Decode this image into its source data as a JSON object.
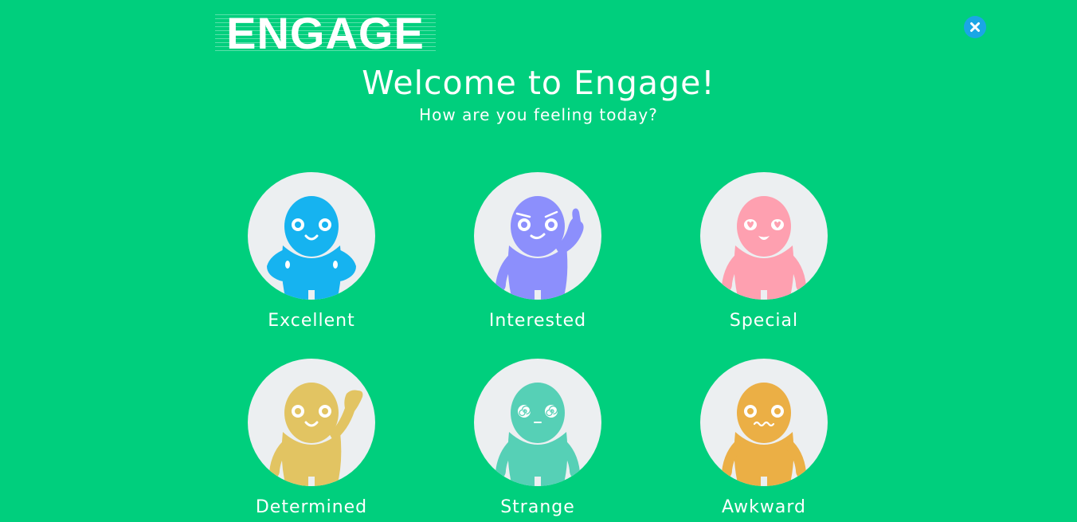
{
  "colors": {
    "background": "#00cf7d",
    "close_button": "#1aa6e6",
    "circle_background": "#eceff1",
    "text": "#ffffff"
  },
  "header": {
    "logo_text": "ENGAGE",
    "close_icon": "close-icon"
  },
  "welcome": {
    "title": "Welcome to Engage!",
    "subtitle": "How are you feeling today?"
  },
  "moods": [
    {
      "label": "Excellent",
      "color": "#16b3f0",
      "pose": "hands-on-hips",
      "face": "smile"
    },
    {
      "label": "Interested",
      "color": "#8c8ffc",
      "pose": "finger-raised",
      "face": "smirk"
    },
    {
      "label": "Special",
      "color": "#fea0b0",
      "pose": "arms-down",
      "face": "heart-eyes"
    },
    {
      "label": "Determined",
      "color": "#e2c462",
      "pose": "fist-raised",
      "face": "smile"
    },
    {
      "label": "Strange",
      "color": "#56d0b6",
      "pose": "arms-down",
      "face": "spiral-eyes"
    },
    {
      "label": "Awkward",
      "color": "#ebaf45",
      "pose": "arms-down",
      "face": "wavy-mouth"
    }
  ]
}
